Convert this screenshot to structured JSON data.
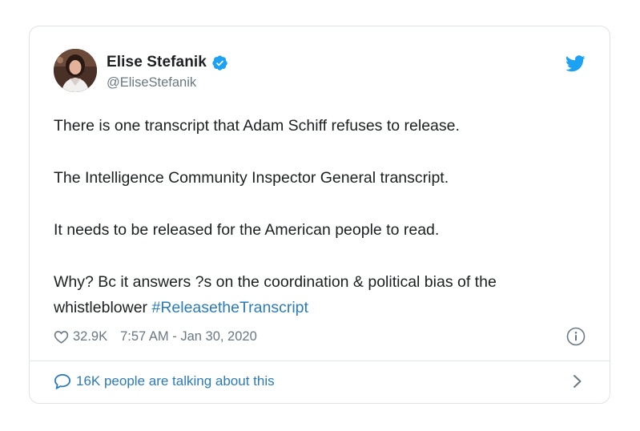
{
  "author": {
    "display_name": "Elise Stefanik",
    "handle": "@EliseStefanik",
    "verified": true
  },
  "tweet": {
    "paragraphs": [
      "There is one transcript that Adam Schiff refuses to release.",
      "The Intelligence Community Inspector General transcript.",
      "It needs to be released for the American people to read."
    ],
    "last_paragraph_text": "Why? Bc it answers ?s on the coordination & political bias of the whistleblower",
    "hashtag": "#ReleasetheTranscript"
  },
  "meta": {
    "likes": "32.9K",
    "timestamp": "7:57 AM - Jan 30, 2020"
  },
  "footer": {
    "talking_label": "16K people are talking about this"
  },
  "icons": {
    "brand": "twitter-bird-icon",
    "verified": "verified-badge-icon",
    "like": "heart-icon",
    "info": "info-icon",
    "reply": "speech-bubble-icon",
    "more": "chevron-right-icon"
  },
  "colors": {
    "brand_blue": "#1da1f2",
    "link_blue": "#2b7bb9",
    "secondary_text": "#697882",
    "primary_text": "#1c2022",
    "border": "#dfe3e6"
  }
}
